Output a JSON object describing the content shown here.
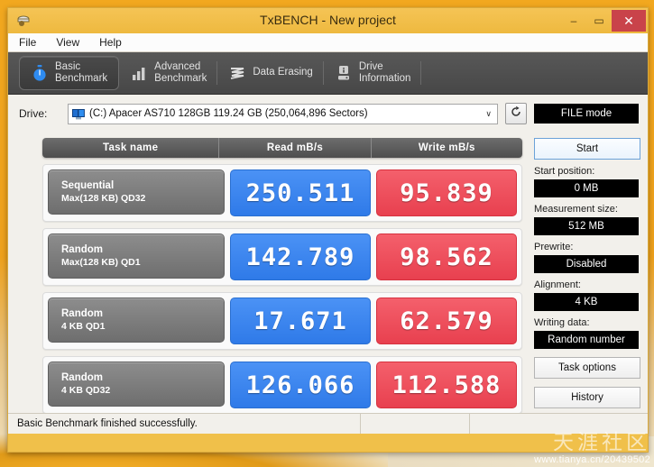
{
  "window": {
    "title": "TxBENCH - New project",
    "icon": "app-icon",
    "controls": {
      "minimize": "–",
      "maximize": "▭",
      "close": "✕"
    }
  },
  "menu": {
    "items": [
      "File",
      "View",
      "Help"
    ]
  },
  "toolbar": {
    "tabs": [
      {
        "label": "Basic\nBenchmark",
        "icon": "stopwatch-icon",
        "active": true
      },
      {
        "label": "Advanced\nBenchmark",
        "icon": "bar-chart-icon",
        "active": false
      },
      {
        "label": "Data Erasing",
        "icon": "shredder-icon",
        "active": false
      },
      {
        "label": "Drive\nInformation",
        "icon": "drive-info-icon",
        "active": false
      }
    ]
  },
  "drive": {
    "label": "Drive:",
    "selected": "(C:) Apacer AS710 128GB  119.24 GB (250,064,896 Sectors)",
    "dropdown_arrow": "∨",
    "refresh_icon": "refresh-icon",
    "mode_badge": "FILE mode"
  },
  "table": {
    "headers": [
      "Task name",
      "Read mB/s",
      "Write mB/s"
    ],
    "rows": [
      {
        "task_line1": "Sequential",
        "task_line2": "Max(128 KB) QD32",
        "read": "250.511",
        "write": "95.839"
      },
      {
        "task_line1": "Random",
        "task_line2": "Max(128 KB) QD1",
        "read": "142.789",
        "write": "98.562"
      },
      {
        "task_line1": "Random",
        "task_line2": "4 KB QD1",
        "read": "17.671",
        "write": "62.579"
      },
      {
        "task_line1": "Random",
        "task_line2": "4 KB QD32",
        "read": "126.066",
        "write": "112.588"
      }
    ]
  },
  "sidebar": {
    "start_button": "Start",
    "fields": [
      {
        "label": "Start position:",
        "value": "0 MB"
      },
      {
        "label": "Measurement size:",
        "value": "512 MB"
      },
      {
        "label": "Prewrite:",
        "value": "Disabled"
      },
      {
        "label": "Alignment:",
        "value": "4 KB"
      },
      {
        "label": "Writing data:",
        "value": "Random number"
      }
    ],
    "task_options_button": "Task options",
    "history_button": "History"
  },
  "status": {
    "message": "Basic Benchmark finished successfully."
  },
  "watermark": {
    "cn": "天涯社区",
    "url": "www.tianya.cn/20439502"
  },
  "colors": {
    "read_chip": "#3d87f0",
    "write_chip": "#ef4a58",
    "title_bar": "#f0c04a",
    "toolbar": "#4e4e4e",
    "close_button": "#c9434a"
  }
}
